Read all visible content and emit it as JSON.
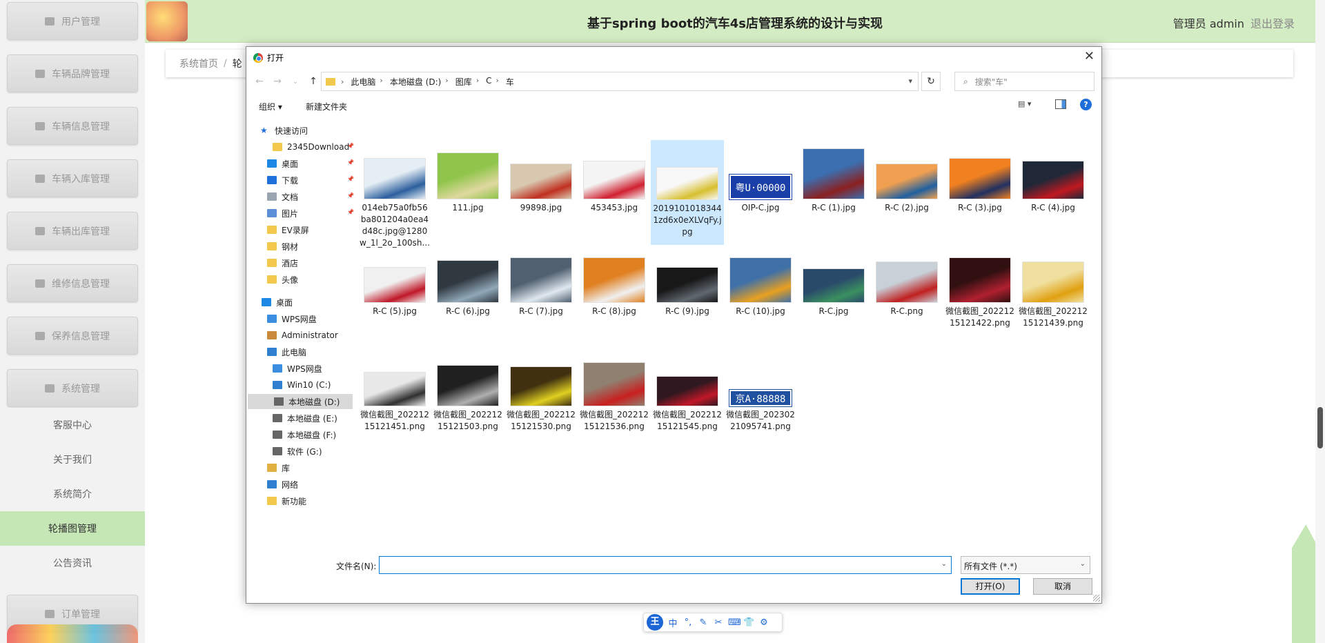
{
  "sidebar": {
    "items": [
      {
        "label": "用户管理",
        "top": 0
      },
      {
        "label": "车辆品牌管理"
      },
      {
        "label": "车辆信息管理"
      },
      {
        "label": "车辆入库管理"
      },
      {
        "label": "车辆出库管理"
      },
      {
        "label": "维修信息管理"
      },
      {
        "label": "保养信息管理"
      },
      {
        "label": "系统管理"
      }
    ],
    "sub_items": [
      {
        "label": "客服中心"
      },
      {
        "label": "关于我们"
      },
      {
        "label": "系统简介"
      },
      {
        "label": "轮播图管理"
      },
      {
        "label": "公告资讯"
      }
    ],
    "last_item": "订单管理"
  },
  "header": {
    "title": "基于spring boot的汽车4s店管理系统的设计与实现",
    "admin": "管理员 admin",
    "logout": "退出登录"
  },
  "breadcrumb": {
    "home": "系统首页",
    "sep": "/",
    "current": "轮"
  },
  "dialog": {
    "title": "打开",
    "path": [
      "此电脑",
      "本地磁盘 (D:)",
      "图库",
      "C",
      "车"
    ],
    "search_placeholder": "搜索\"车\"",
    "organize": "组织 ▾",
    "new_folder": "新建文件夹",
    "tree": [
      {
        "label": "快速访问",
        "icon": "star-icon",
        "color": "#1e6fd9"
      },
      {
        "label": "2345Download",
        "icon": "folder-icon",
        "color": "#f2c94c",
        "pin": true
      },
      {
        "label": "桌面",
        "icon": "desktop-icon",
        "color": "#1e88e5",
        "pin": true
      },
      {
        "label": "下载",
        "icon": "download-icon",
        "color": "#1e6fd9",
        "pin": true
      },
      {
        "label": "文档",
        "icon": "document-icon",
        "color": "#9aa5b1",
        "pin": true
      },
      {
        "label": "图片",
        "icon": "picture-icon",
        "color": "#5a8fd8",
        "pin": true
      },
      {
        "label": "EV录屏",
        "icon": "folder-icon",
        "color": "#f2c94c"
      },
      {
        "label": "钢材",
        "icon": "folder-icon",
        "color": "#f2c94c"
      },
      {
        "label": "酒店",
        "icon": "folder-icon",
        "color": "#f2c94c"
      },
      {
        "label": "头像",
        "icon": "folder-icon",
        "color": "#f2c94c"
      },
      {
        "label": "桌面",
        "icon": "desktop-icon",
        "color": "#1e88e5"
      },
      {
        "label": "WPS网盘",
        "icon": "cloud-icon",
        "color": "#3b8de0"
      },
      {
        "label": "Administrator",
        "icon": "user-icon",
        "color": "#c98a3c"
      },
      {
        "label": "此电脑",
        "icon": "computer-icon",
        "color": "#2f80d1"
      },
      {
        "label": "WPS网盘",
        "icon": "cloud-icon",
        "color": "#3b8de0"
      },
      {
        "label": "Win10 (C:)",
        "icon": "windows-drive-icon",
        "color": "#2f80d1"
      },
      {
        "label": "本地磁盘 (D:)",
        "icon": "drive-icon",
        "color": "#666",
        "selected": true
      },
      {
        "label": "本地磁盘 (E:)",
        "icon": "drive-icon",
        "color": "#666"
      },
      {
        "label": "本地磁盘 (F:)",
        "icon": "drive-icon",
        "color": "#666"
      },
      {
        "label": "软件 (G:)",
        "icon": "drive-icon",
        "color": "#666"
      },
      {
        "label": "库",
        "icon": "library-icon",
        "color": "#e0b040"
      },
      {
        "label": "网络",
        "icon": "network-icon",
        "color": "#2f80d1"
      },
      {
        "label": "新功能",
        "icon": "folder-icon",
        "color": "#f2c94c"
      }
    ],
    "files": [
      {
        "name": "014eb75a0fb56ba801204a0ea4d48c.jpg@1280w_1l_2o_100sh...",
        "colors": [
          "#e6eef5",
          "#2c5f9e"
        ]
      },
      {
        "name": "111.jpg",
        "colors": [
          "#8fc54a",
          "#e0d8a0"
        ]
      },
      {
        "name": "99898.jpg",
        "colors": [
          "#d8c8b0",
          "#c03020"
        ]
      },
      {
        "name": "453453.jpg",
        "colors": [
          "#f4f4f4",
          "#d02030"
        ]
      },
      {
        "name": "20191010183441zd6x0eXLVqFy.jpg",
        "colors": [
          "#f8f8f8",
          "#d8c030"
        ],
        "selected": true
      },
      {
        "name": "OIP-C.jpg",
        "colors": [
          "#1a3fa8",
          "#ffffff"
        ],
        "plate": "粤U·00000"
      },
      {
        "name": "R-C (1).jpg",
        "colors": [
          "#3b6fb0",
          "#8b2020"
        ]
      },
      {
        "name": "R-C (2).jpg",
        "colors": [
          "#f0a050",
          "#2060a0"
        ]
      },
      {
        "name": "R-C (3).jpg",
        "colors": [
          "#f08020",
          "#203060"
        ]
      },
      {
        "name": "R-C (4).jpg",
        "colors": [
          "#202838",
          "#c01820"
        ]
      },
      {
        "name": "R-C (5).jpg",
        "colors": [
          "#f0f0f0",
          "#c01828"
        ]
      },
      {
        "name": "R-C (6).jpg",
        "colors": [
          "#303840",
          "#90a8b8"
        ]
      },
      {
        "name": "R-C (7).jpg",
        "colors": [
          "#506070",
          "#e0e8f0"
        ]
      },
      {
        "name": "R-C (8).jpg",
        "colors": [
          "#e08020",
          "#f0f0f0"
        ]
      },
      {
        "name": "R-C (9).jpg",
        "colors": [
          "#181818",
          "#606870"
        ]
      },
      {
        "name": "R-C (10).jpg",
        "colors": [
          "#4070a8",
          "#e8a020"
        ]
      },
      {
        "name": "R-C.jpg",
        "colors": [
          "#2a4a6a",
          "#3a9060"
        ]
      },
      {
        "name": "R-C.png",
        "colors": [
          "#c8d0d8",
          "#c02020"
        ]
      },
      {
        "name": "微信截图_20221215121422.png",
        "colors": [
          "#301010",
          "#b02030"
        ]
      },
      {
        "name": "微信截图_20221215121439.png",
        "colors": [
          "#f0e0a0",
          "#e0a010"
        ]
      },
      {
        "name": "微信截图_20221215121451.png",
        "colors": [
          "#e8e8e8",
          "#303030"
        ]
      },
      {
        "name": "微信截图_20221215121503.png",
        "colors": [
          "#202020",
          "#b0b0b0"
        ]
      },
      {
        "name": "微信截图_20221215121530.png",
        "colors": [
          "#403010",
          "#e0d020"
        ]
      },
      {
        "name": "微信截图_20221215121536.png",
        "colors": [
          "#908070",
          "#c82020"
        ]
      },
      {
        "name": "微信截图_20221215121545.png",
        "colors": [
          "#301820",
          "#c01828"
        ]
      },
      {
        "name": "微信截图_20230221095741.png",
        "colors": [
          "#2050a0",
          "#ffffff"
        ],
        "plate": "京A·88888"
      }
    ],
    "filename_label": "文件名(N):",
    "filename_value": "",
    "filetype": "所有文件 (*.*)",
    "open": "打开(O)",
    "cancel": "取消"
  },
  "ime": {
    "logo": "王",
    "items": [
      "中",
      "°,",
      "✎",
      "✂",
      "⌨",
      "👕",
      "⚙"
    ]
  }
}
